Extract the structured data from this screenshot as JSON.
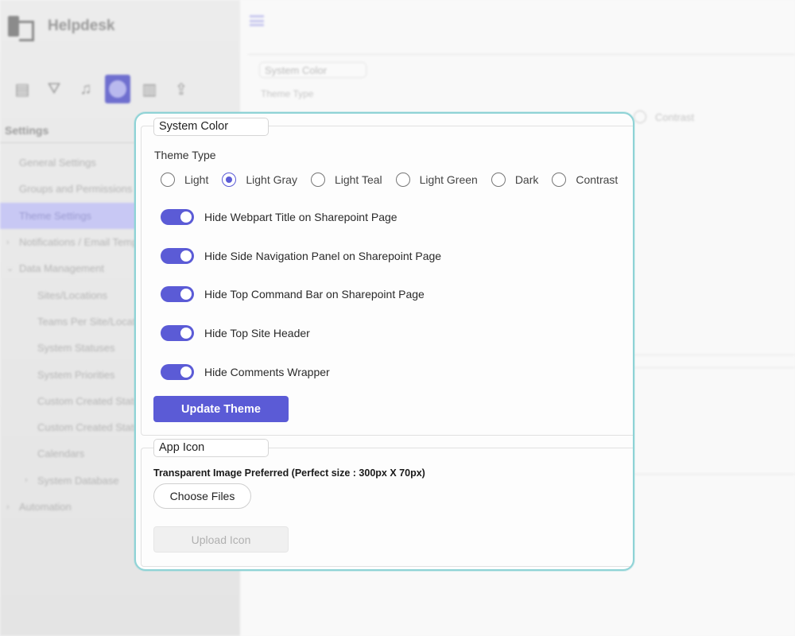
{
  "app": {
    "name": "Helpdesk"
  },
  "sidebar": {
    "heading": "Settings",
    "icons": [
      "list-icon",
      "filter-icon",
      "bell-icon",
      "palette-icon",
      "chart-icon",
      "share-icon"
    ],
    "items": [
      {
        "label": "General Settings",
        "level": 1
      },
      {
        "label": "Groups and Permissions",
        "level": 1
      },
      {
        "label": "Theme Settings",
        "level": 1,
        "active": true
      },
      {
        "label": "Notifications / Email Templates",
        "level": 1,
        "chevron": "›"
      },
      {
        "label": "Data Management",
        "level": 1,
        "chevron": "⌄"
      },
      {
        "label": "Sites/Locations",
        "level": 2
      },
      {
        "label": "Teams Per Site/Location",
        "level": 2
      },
      {
        "label": "System Statuses",
        "level": 2
      },
      {
        "label": "System Priorities",
        "level": 2
      },
      {
        "label": "Custom Created Statuses",
        "level": 2
      },
      {
        "label": "Custom Created Status Types",
        "level": 2
      },
      {
        "label": "Calendars",
        "level": 2
      },
      {
        "label": "System Database",
        "level": 2,
        "chevron": "›"
      },
      {
        "label": "Automation",
        "level": 1,
        "chevron": "›"
      }
    ]
  },
  "background": {
    "system_color_legend": "System Color",
    "theme_type": "Theme Type",
    "contrast": "Contrast"
  },
  "system_color": {
    "legend": "System Color",
    "theme_type_label": "Theme Type",
    "themes": [
      {
        "label": "Light",
        "checked": false
      },
      {
        "label": "Light Gray",
        "checked": true
      },
      {
        "label": "Light Teal",
        "checked": false
      },
      {
        "label": "Light Green",
        "checked": false
      },
      {
        "label": "Dark",
        "checked": false
      },
      {
        "label": "Contrast",
        "checked": false
      }
    ],
    "toggles": [
      {
        "label": "Hide Webpart Title on Sharepoint Page",
        "on": true
      },
      {
        "label": "Hide Side Navigation Panel on Sharepoint Page",
        "on": true
      },
      {
        "label": "Hide Top Command Bar on Sharepoint Page",
        "on": true
      },
      {
        "label": "Hide Top Site Header",
        "on": true
      },
      {
        "label": "Hide Comments Wrapper",
        "on": true
      }
    ],
    "update_button": "Update Theme"
  },
  "app_icon": {
    "legend": "App Icon",
    "hint": "Transparent Image Preferred (Perfect size : 300px X 70px)",
    "choose_button": "Choose Files",
    "upload_button": "Upload Icon"
  },
  "colors": {
    "accent": "#5b5bd6",
    "card_border": "#8fd3d6",
    "active_nav": "#c8c8f4"
  }
}
